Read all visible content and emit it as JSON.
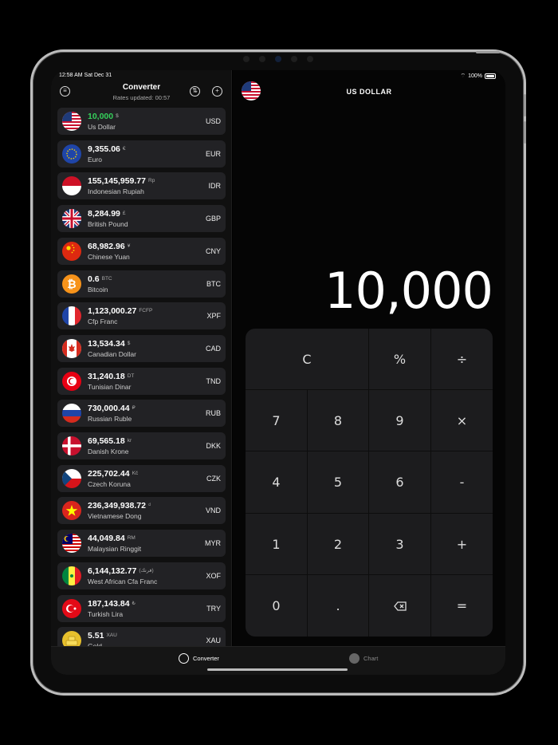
{
  "status": {
    "time": "12:58 AM   Sat Dec 31",
    "battery": "100%"
  },
  "sidebar": {
    "title": "Converter",
    "subtitle": "Rates updated: 00:57",
    "items": [
      {
        "value": "10,000",
        "symbol": "$",
        "name": "Us Dollar",
        "code": "USD",
        "flag": "us"
      },
      {
        "value": "9,355.06",
        "symbol": "€",
        "name": "Euro",
        "code": "EUR",
        "flag": "eu"
      },
      {
        "value": "155,145,959.77",
        "symbol": "Rp",
        "name": "Indonesian Rupiah",
        "code": "IDR",
        "flag": "id"
      },
      {
        "value": "8,284.99",
        "symbol": "£",
        "name": "British Pound",
        "code": "GBP",
        "flag": "gb"
      },
      {
        "value": "68,982.96",
        "symbol": "¥",
        "name": "Chinese Yuan",
        "code": "CNY",
        "flag": "cn"
      },
      {
        "value": "0.6",
        "symbol": "BTC",
        "name": "Bitcoin",
        "code": "BTC",
        "flag": "btc"
      },
      {
        "value": "1,123,000.27",
        "symbol": "FCFP",
        "name": "Cfp Franc",
        "code": "XPF",
        "flag": "fr"
      },
      {
        "value": "13,534.34",
        "symbol": "$",
        "name": "Canadian Dollar",
        "code": "CAD",
        "flag": "ca"
      },
      {
        "value": "31,240.18",
        "symbol": "DT",
        "name": "Tunisian Dinar",
        "code": "TND",
        "flag": "tn"
      },
      {
        "value": "730,000.44",
        "symbol": "₽",
        "name": "Russian Ruble",
        "code": "RUB",
        "flag": "ru"
      },
      {
        "value": "69,565.18",
        "symbol": "kr",
        "name": "Danish Krone",
        "code": "DKK",
        "flag": "dk"
      },
      {
        "value": "225,702.44",
        "symbol": "Kč",
        "name": "Czech Koruna",
        "code": "CZK",
        "flag": "cz"
      },
      {
        "value": "236,349,938.72",
        "symbol": "₫",
        "name": "Vietnamese Dong",
        "code": "VND",
        "flag": "vn"
      },
      {
        "value": "44,049.84",
        "symbol": "RM",
        "name": "Malaysian Ringgit",
        "code": "MYR",
        "flag": "my"
      },
      {
        "value": "6,144,132.77",
        "symbol": "(فرنك)",
        "name": "West African Cfa Franc",
        "code": "XOF",
        "flag": "sn"
      },
      {
        "value": "187,143.84",
        "symbol": "₺",
        "name": "Turkish Lira",
        "code": "TRY",
        "flag": "tr"
      },
      {
        "value": "5.51",
        "symbol": "XAU",
        "name": "Gold",
        "code": "XAU",
        "flag": "xau"
      }
    ]
  },
  "main": {
    "title": "US DOLLAR",
    "display": "10,000",
    "keys": {
      "clear": "C",
      "percent": "%",
      "divide": "÷",
      "seven": "7",
      "eight": "8",
      "nine": "9",
      "multiply": "×",
      "four": "4",
      "five": "5",
      "six": "6",
      "minus": "-",
      "one": "1",
      "two": "2",
      "three": "3",
      "plus": "+",
      "zero": "0",
      "dot": ".",
      "equals": "="
    }
  },
  "tabs": {
    "converter": "Converter",
    "chart": "Chart"
  },
  "colors": {
    "active_value": "#35d05b",
    "row_bg": "#222225",
    "keypad_bg": "#1c1c1e"
  }
}
